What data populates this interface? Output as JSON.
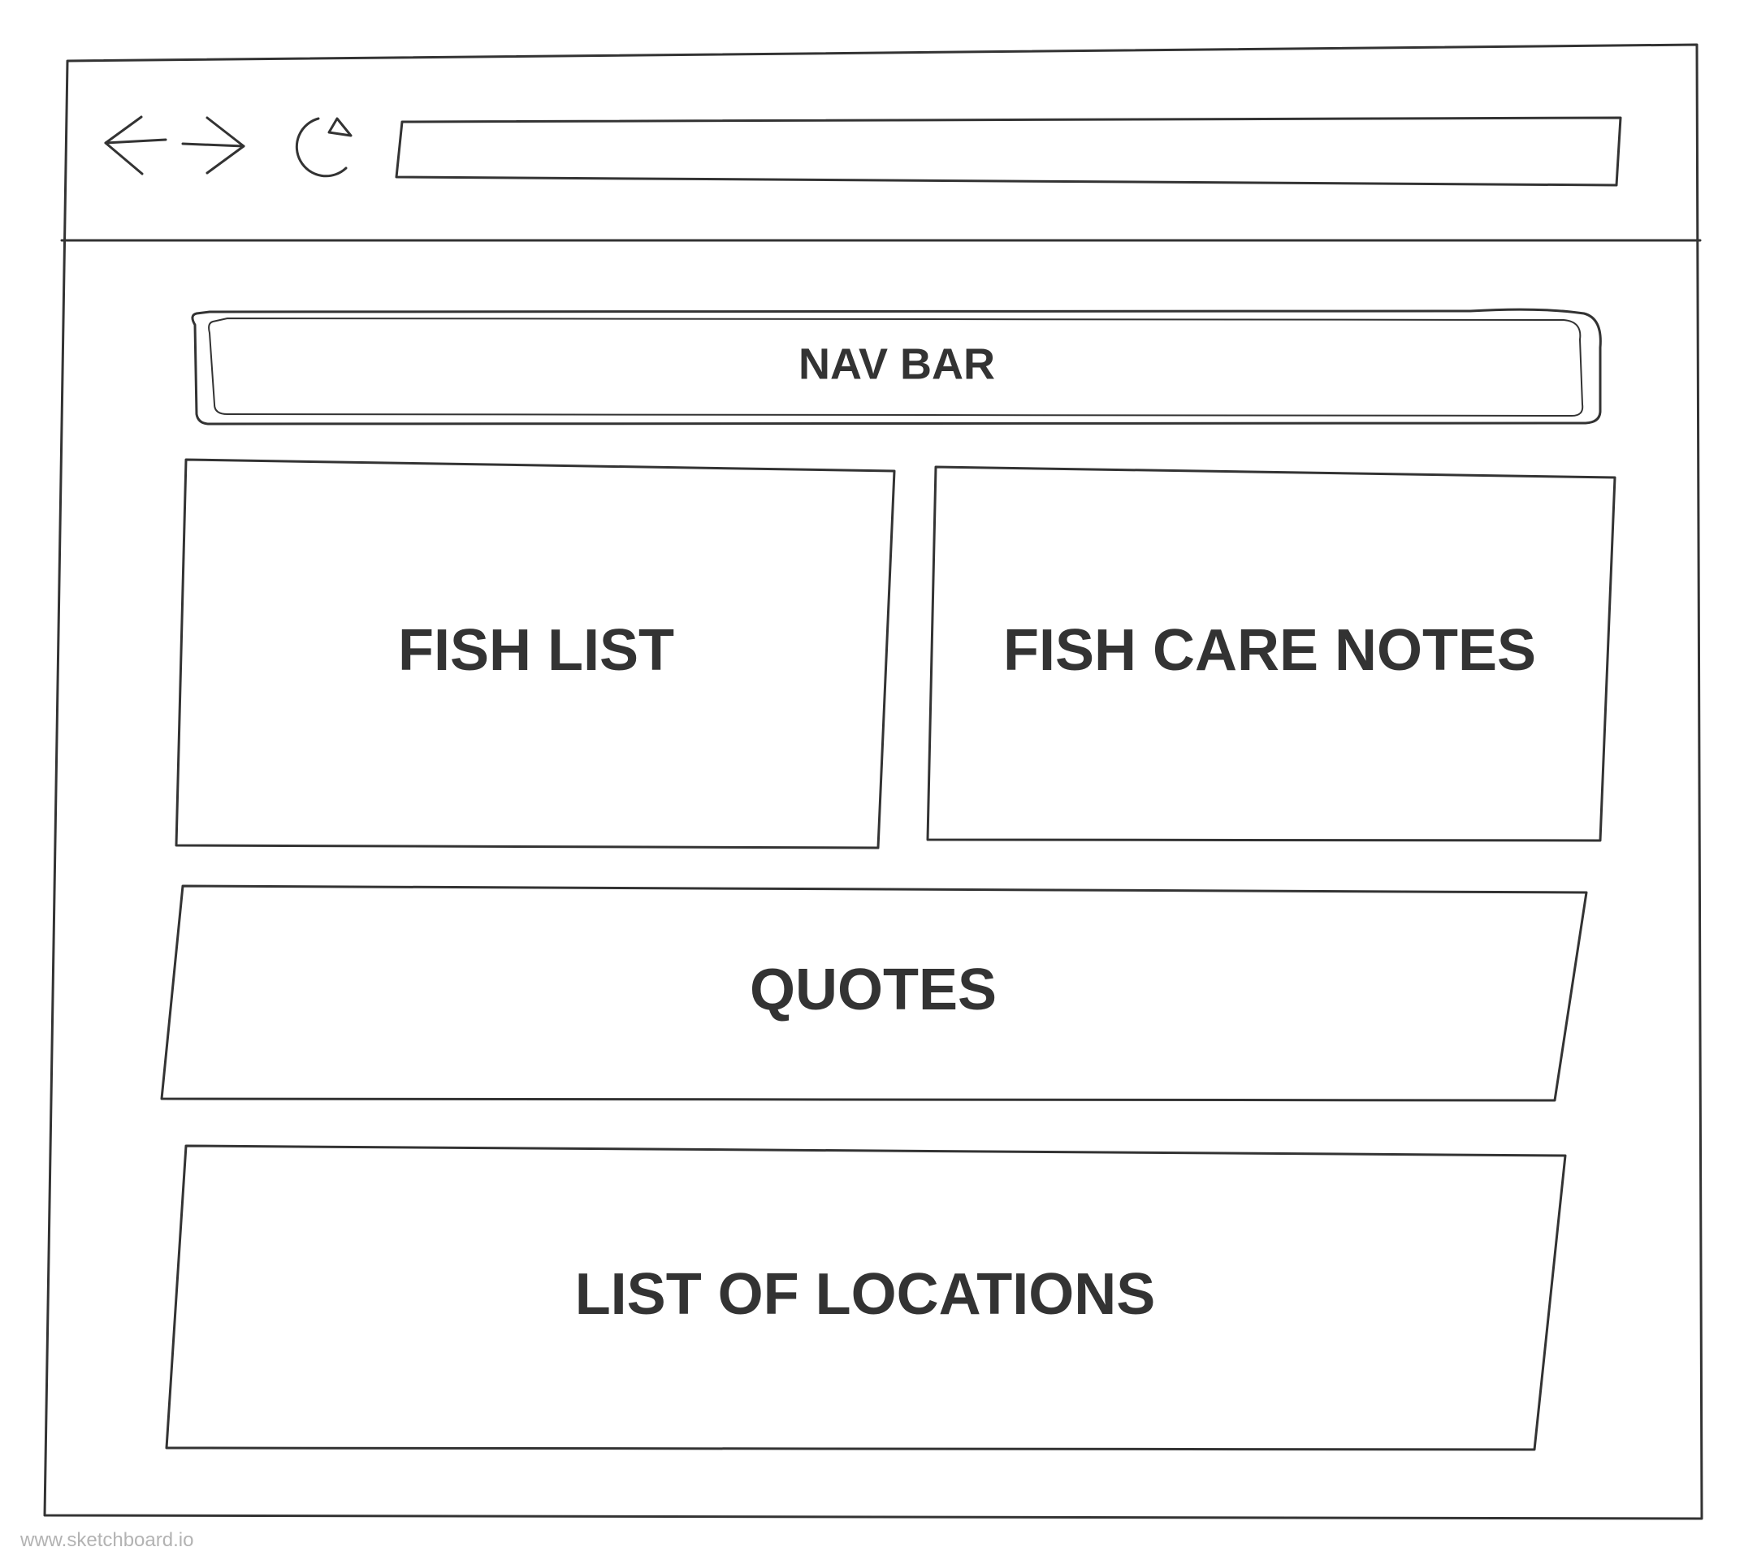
{
  "browser": {
    "back_icon": "arrow-left-icon",
    "forward_icon": "arrow-right-icon",
    "reload_icon": "reload-icon",
    "address_bar_value": ""
  },
  "nav_bar": {
    "label": "NAV BAR"
  },
  "panels": {
    "fish_list": "FISH LIST",
    "fish_care_notes": "FISH CARE NOTES",
    "quotes": "QUOTES",
    "list_of_locations": "LIST OF LOCATIONS"
  },
  "watermark": "www.sketchboard.io",
  "colors": {
    "ink": "#333333",
    "background": "#ffffff",
    "watermark": "#b3b3b3"
  }
}
